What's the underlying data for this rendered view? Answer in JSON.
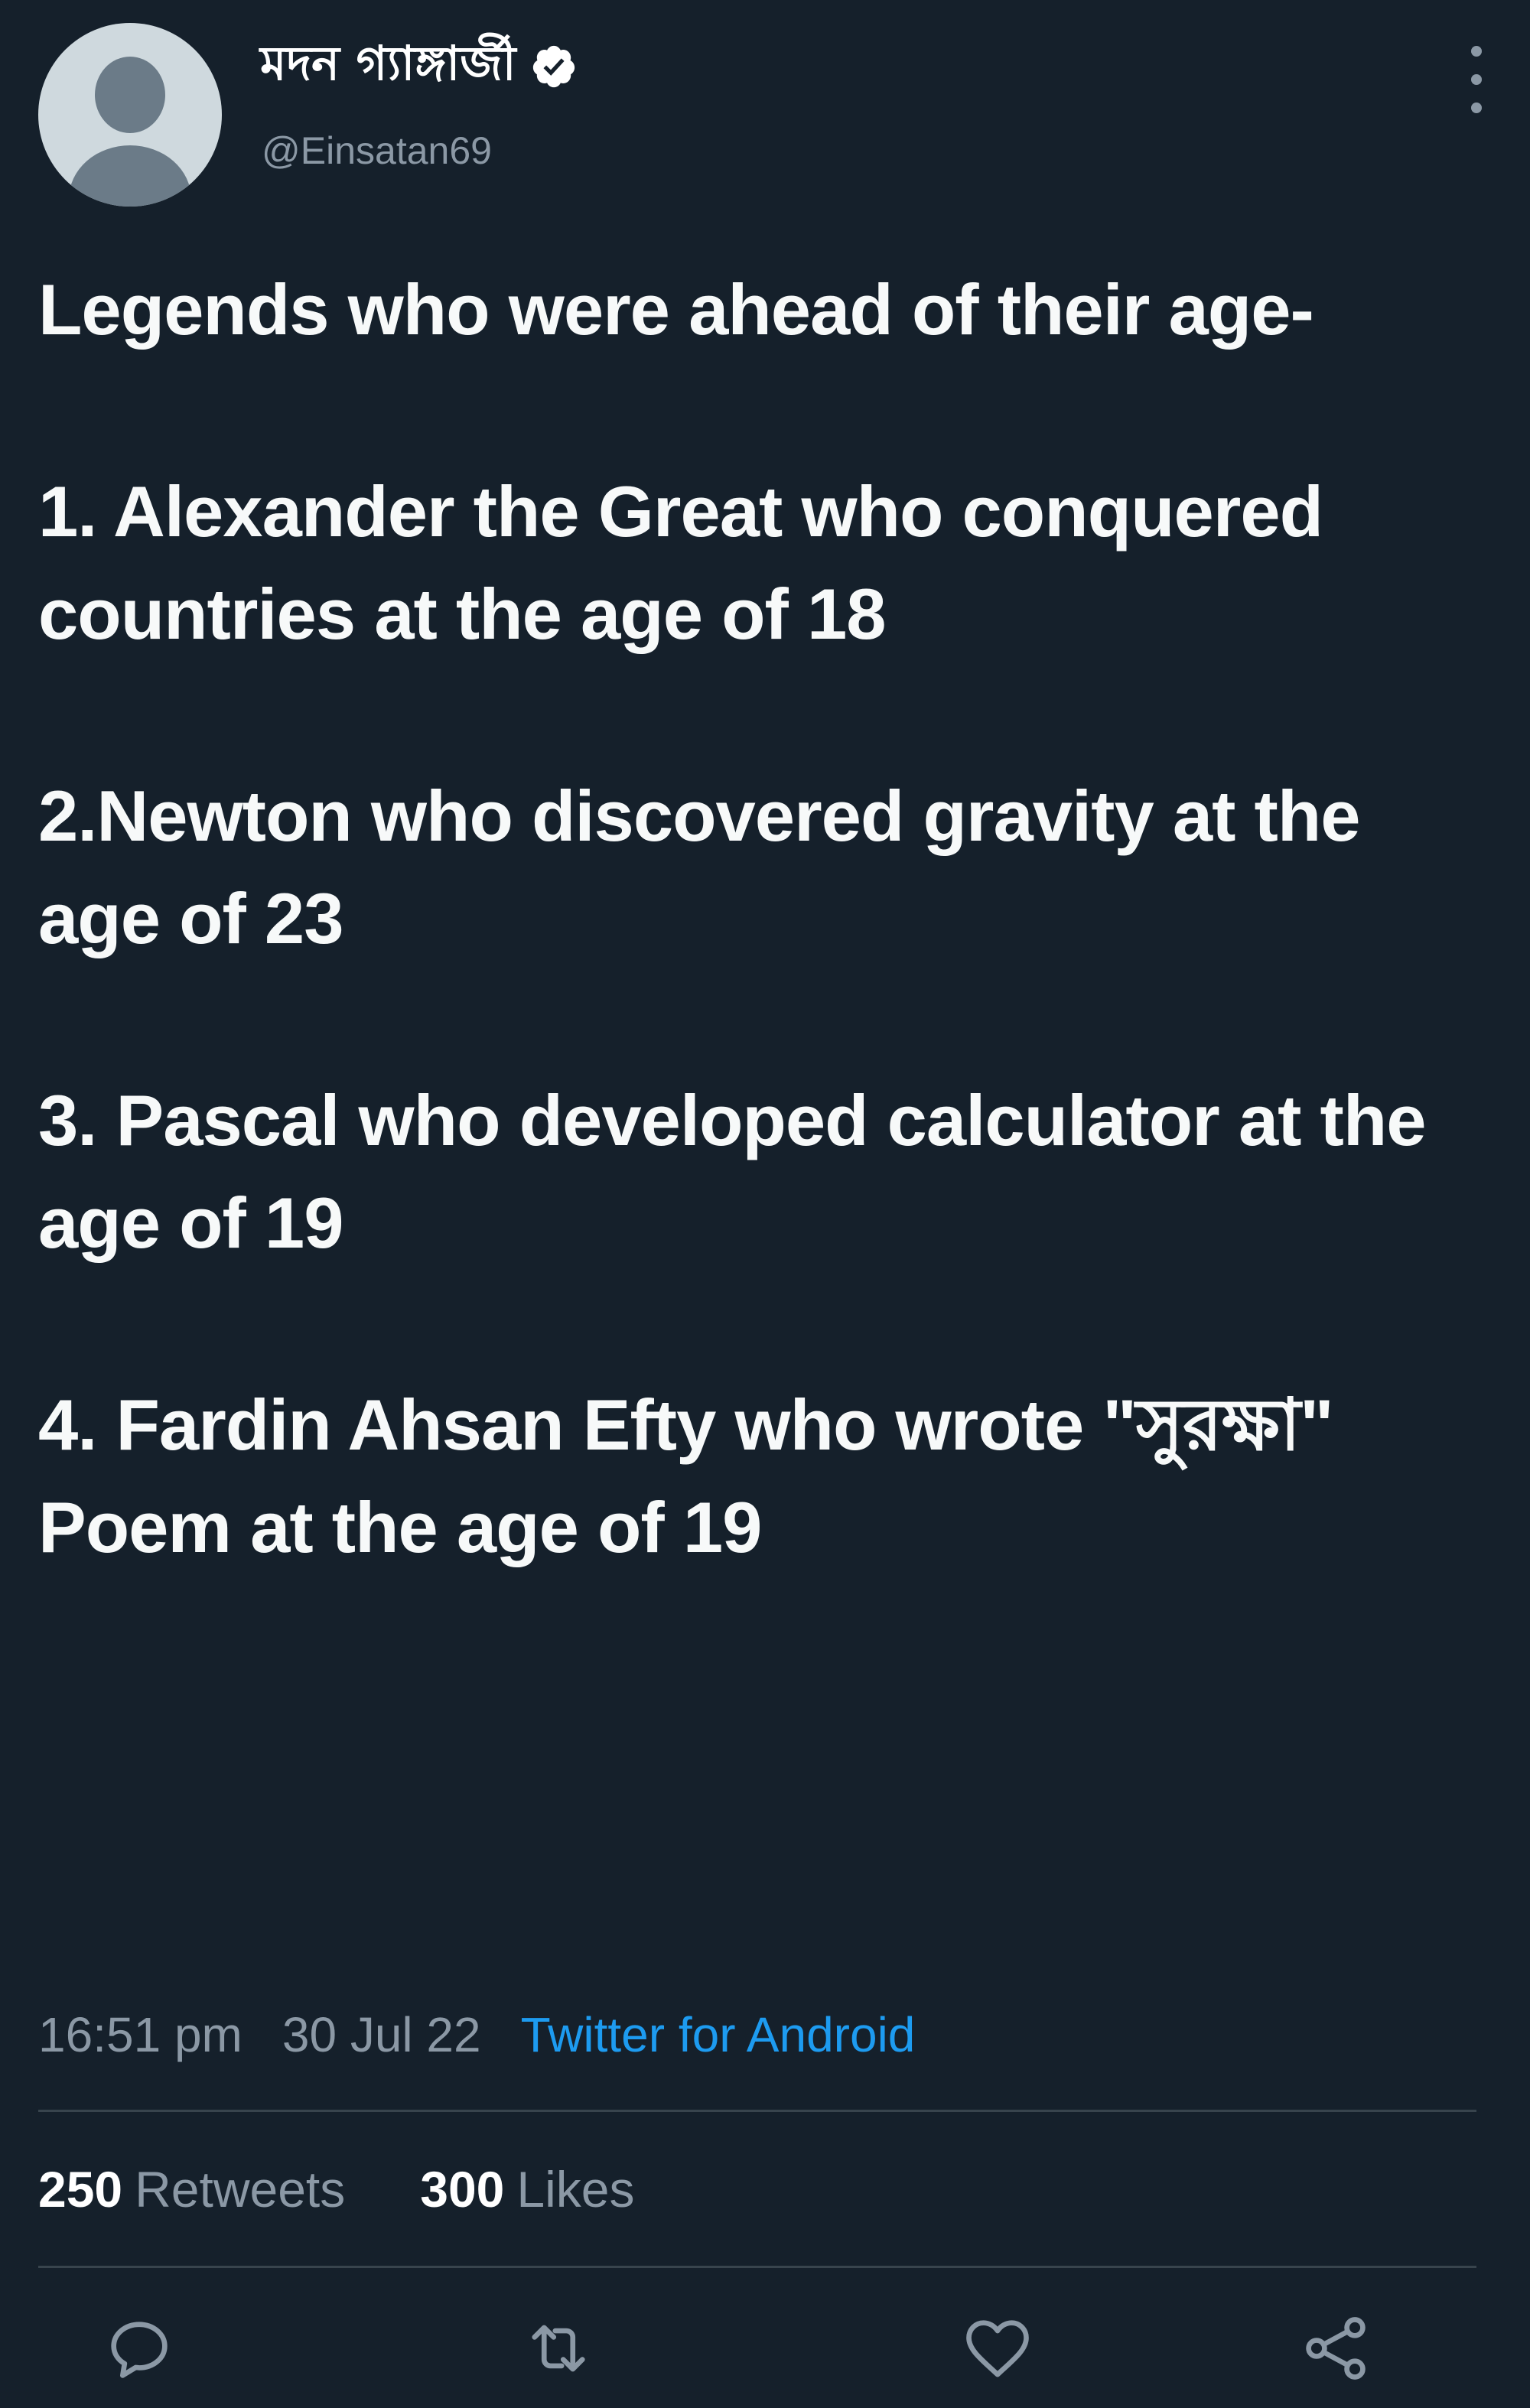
{
  "author": {
    "display_name": "মদন গ্যাঙ্গার্জী",
    "handle": "@Einsatan69",
    "verified": true,
    "avatar_icon": "default-avatar-icon"
  },
  "tweet": {
    "paragraphs": [
      "Legends who were ahead of their age-",
      "1. Alexander the Great who conquered countries at the age of 18",
      "2.Newton who discovered gravity at the age of 23",
      "3. Pascal who developed calculator at the age of 19",
      "4. Fardin Ahsan Efty who wrote \"সুরক্ষা\" Poem at the age of 19"
    ]
  },
  "meta": {
    "time": "16:51 pm",
    "date": "30 Jul 22",
    "source": "Twitter for Android"
  },
  "stats": {
    "retweets_count": "250",
    "retweets_label": "Retweets",
    "likes_count": "300",
    "likes_label": "Likes"
  },
  "actions": {
    "reply_icon": "reply-icon",
    "retweet_icon": "retweet-icon",
    "like_icon": "heart-icon",
    "share_icon": "share-icon"
  },
  "colors": {
    "background": "#15202b",
    "text_primary": "#ffffff",
    "text_secondary": "#8b98a5",
    "accent": "#1d9bf0",
    "divider": "#38444d"
  }
}
